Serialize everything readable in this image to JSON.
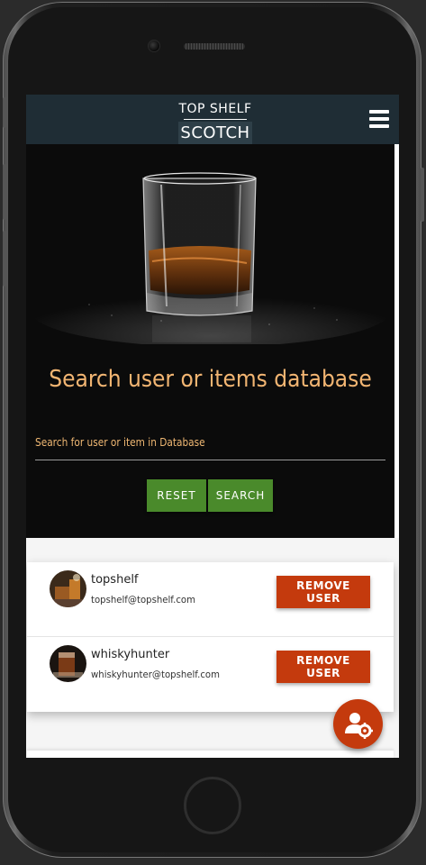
{
  "app": {
    "logo_top": "TOP SHELF",
    "logo_bottom": "SCOTCH",
    "menu_icon": "hamburger-icon"
  },
  "hero": {
    "image_icon": "whisky-glass-image",
    "title": "Search user or items database",
    "search_label": "Search for user or item in Database",
    "search_value": "",
    "reset_label": "RESET",
    "search_label_btn": "SEARCH"
  },
  "users": [
    {
      "username": "topshelf",
      "email": "topshelf@topshelf.com",
      "remove_label": "REMOVE USER"
    },
    {
      "username": "whiskyhunter",
      "email": "whiskyhunter@topshelf.com",
      "remove_label": "REMOVE USER"
    }
  ],
  "fab": {
    "icon": "user-settings-icon"
  },
  "colors": {
    "navbar": "#1f2d35",
    "accent_orange": "#c43a0d",
    "green_button": "#4a8a2b",
    "title_gold": "#f2b572"
  }
}
